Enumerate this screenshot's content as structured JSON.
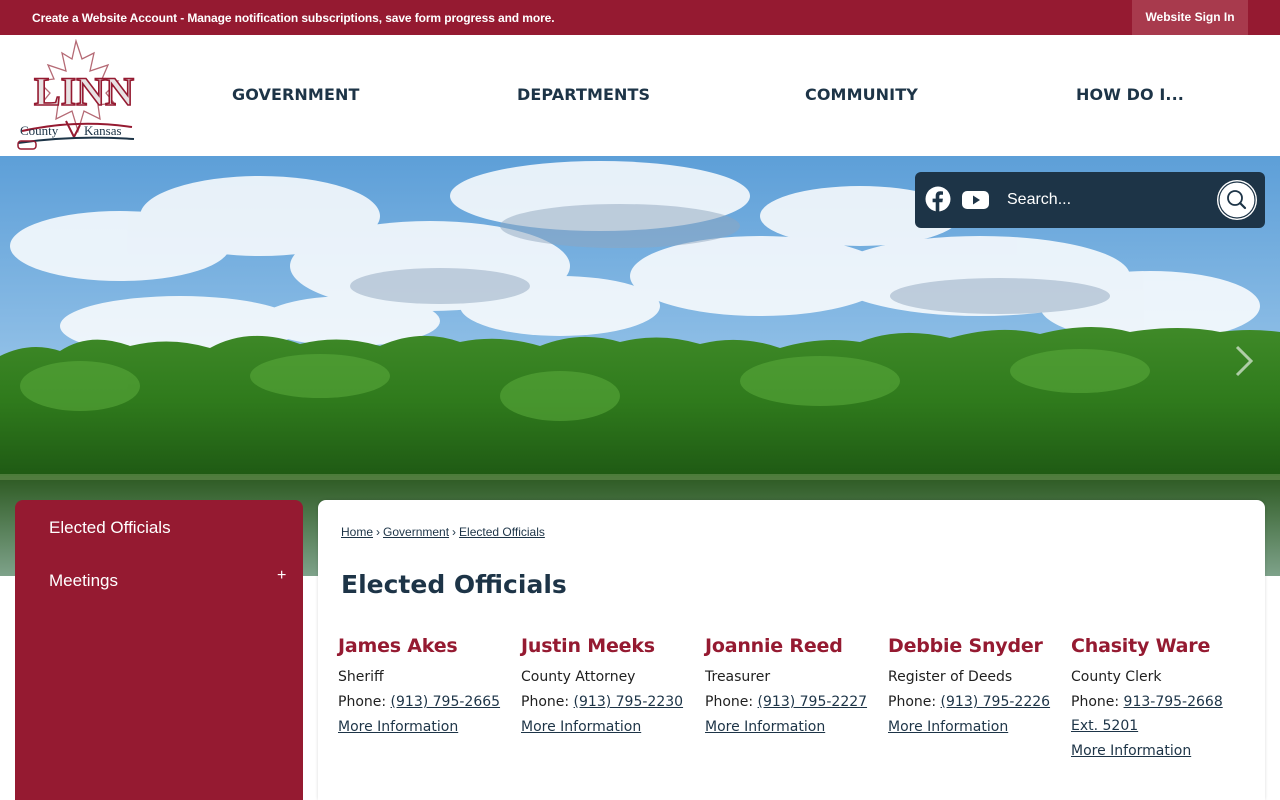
{
  "topbar": {
    "message": "Create a Website Account - Manage notification subscriptions, save form progress and more.",
    "signin_label": "Website Sign In"
  },
  "brand": {
    "logo_line1": "LINN",
    "logo_line2": "County Kansas",
    "primary_color": "#951a31",
    "navy_color": "#1d3447"
  },
  "nav": {
    "items": [
      {
        "label": "GOVERNMENT"
      },
      {
        "label": "DEPARTMENTS"
      },
      {
        "label": "COMMUNITY"
      },
      {
        "label": "HOW DO I..."
      }
    ]
  },
  "search": {
    "placeholder": "Search...",
    "social": [
      "facebook-icon",
      "youtube-icon"
    ],
    "button_icon": "search-icon"
  },
  "sidebar": {
    "items": [
      {
        "label": "Elected Officials"
      },
      {
        "label": "Meetings",
        "expand": "+"
      }
    ]
  },
  "breadcrumb": {
    "items": [
      "Home",
      "Government",
      "Elected Officials"
    ],
    "separator": "›"
  },
  "page": {
    "title": "Elected Officials"
  },
  "officials": [
    {
      "name": "James Akes",
      "title": "Sheriff",
      "phone_label": "Phone:",
      "phone": "(913) 795-2665",
      "more": "More Information"
    },
    {
      "name": "Justin Meeks",
      "title": "County Attorney",
      "phone_label": "Phone:",
      "phone": "(913) 795-2230",
      "more": "More Information"
    },
    {
      "name": "Joannie Reed",
      "title": "Treasurer",
      "phone_label": "Phone:",
      "phone": "(913) 795-2227",
      "more": "More Information"
    },
    {
      "name": "Debbie Snyder",
      "title": "Register of Deeds",
      "phone_label": "Phone:",
      "phone": "(913) 795-2226",
      "more": "More Information"
    },
    {
      "name": "Chasity Ware",
      "title": "County Clerk",
      "phone_label": "Phone:",
      "phone": "913-795-2668",
      "phone_ext": "Ext. 5201",
      "more": "More Information"
    }
  ]
}
